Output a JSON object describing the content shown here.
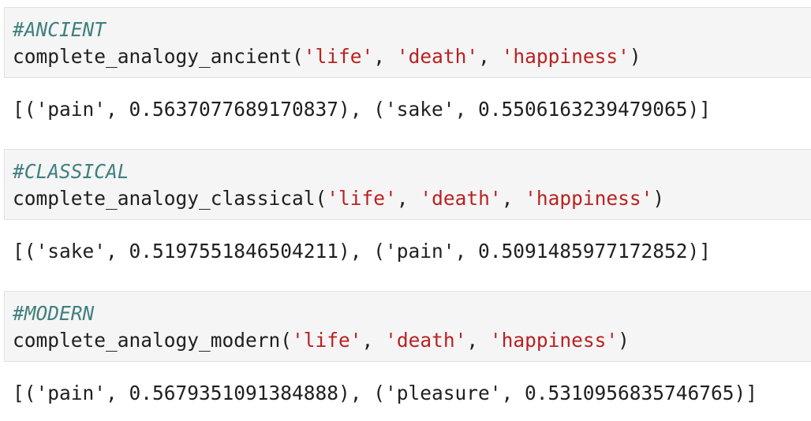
{
  "cells": [
    {
      "comment": "#ANCIENT",
      "call": {
        "func": "complete_analogy_ancient",
        "open": "(",
        "args": [
          "'life'",
          "'death'",
          "'happiness'"
        ],
        "sep": ", ",
        "close": ")"
      },
      "output": "[('pain', 0.5637077689170837), ('sake', 0.5506163239479065)]"
    },
    {
      "comment": "#CLASSICAL",
      "call": {
        "func": "complete_analogy_classical",
        "open": "(",
        "args": [
          "'life'",
          "'death'",
          "'happiness'"
        ],
        "sep": ", ",
        "close": ")"
      },
      "output": "[('sake', 0.5197551846504211), ('pain', 0.5091485977172852)]"
    },
    {
      "comment": "#MODERN",
      "call": {
        "func": "complete_analogy_modern",
        "open": "(",
        "args": [
          "'life'",
          "'death'",
          "'happiness'"
        ],
        "sep": ", ",
        "close": ")"
      },
      "output": "[('pain', 0.5679351091384888), ('pleasure', 0.5310956835746765)]"
    }
  ]
}
